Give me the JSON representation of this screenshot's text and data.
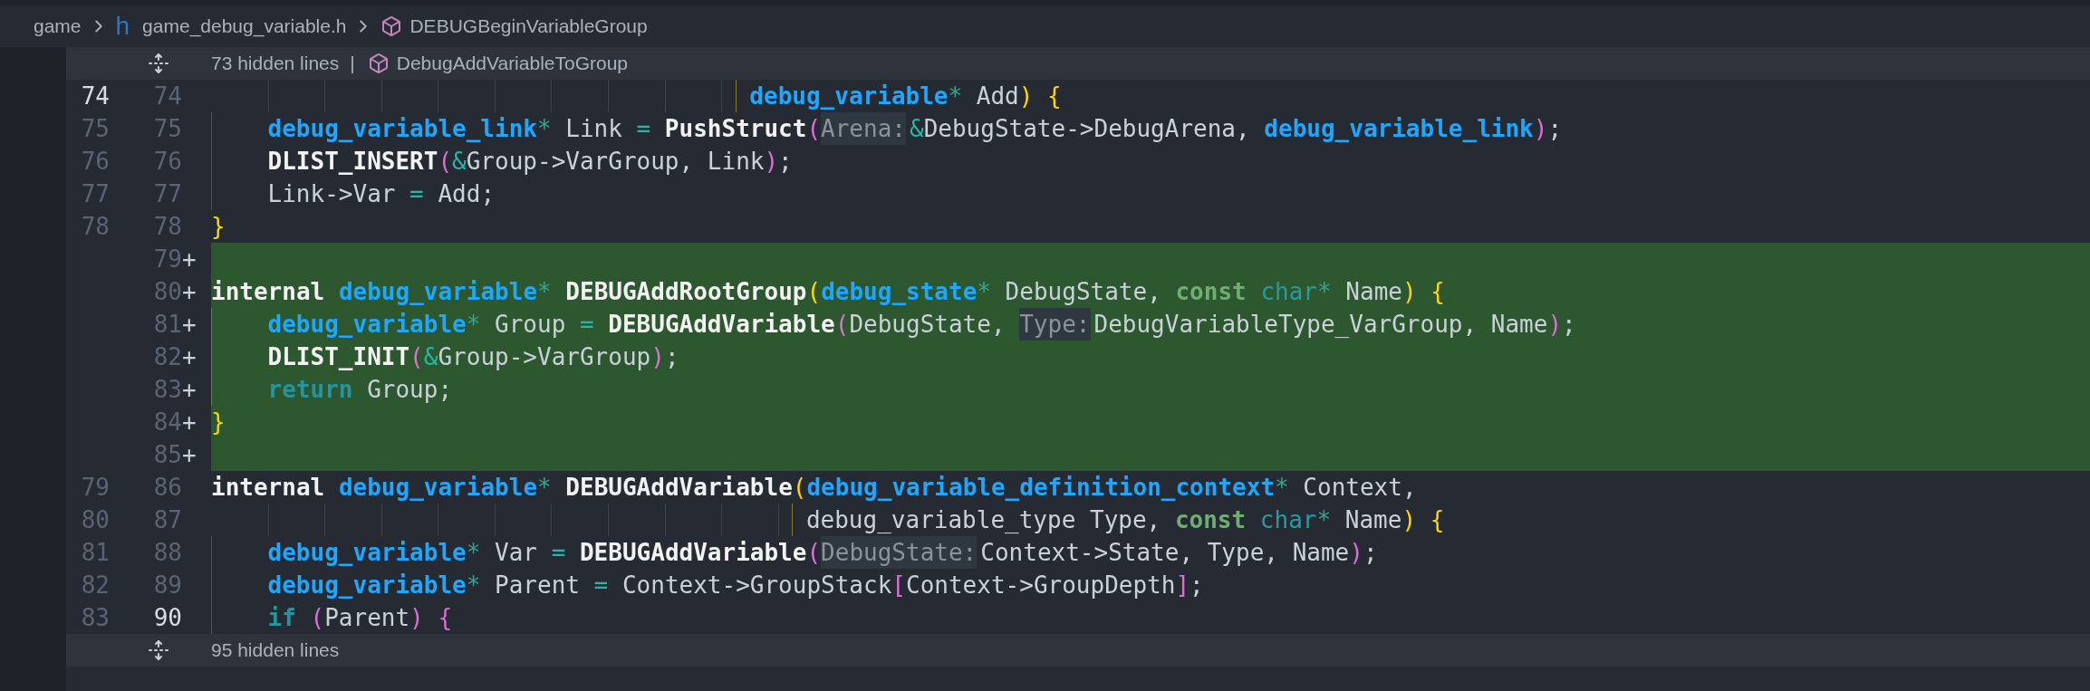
{
  "breadcrumb": {
    "folder": "game",
    "file_icon": "h",
    "file": "game_debug_variable.h",
    "symbol": "DEBUGBeginVariableGroup"
  },
  "rows": [
    {
      "kind": "fold",
      "text": "73 hidden lines",
      "separator": "|",
      "symbol": "DebugAddVariableToGroup"
    },
    {
      "kind": "code",
      "old": {
        "text": "74",
        "current": true
      },
      "new": {
        "text": "74",
        "current": false
      },
      "added": false,
      "indent": "                                      ",
      "scope_guide": false,
      "bracket_guide": true,
      "tokens": [
        {
          "kind": "type",
          "text": "debug_variable"
        },
        {
          "kind": "star",
          "text": "*"
        },
        {
          "kind": "plain",
          "text": " Add"
        },
        {
          "kind": "p1",
          "text": ")"
        },
        {
          "kind": "p1",
          "text": " {"
        }
      ]
    },
    {
      "kind": "code",
      "old": {
        "text": "75",
        "current": false
      },
      "new": {
        "text": "75",
        "current": false
      },
      "added": false,
      "indent": "    ",
      "scope_guide": true,
      "bracket_guide": false,
      "tokens": [
        {
          "kind": "type",
          "text": "debug_variable_link"
        },
        {
          "kind": "star",
          "text": "*"
        },
        {
          "kind": "plain",
          "text": " Link "
        },
        {
          "kind": "op",
          "text": "="
        },
        {
          "kind": "func",
          "text": " PushStruct"
        },
        {
          "kind": "p2",
          "text": "("
        },
        {
          "kind": "hint",
          "text": "Arena:"
        },
        {
          "kind": "op",
          "text": "&"
        },
        {
          "kind": "plain",
          "text": "DebugState->DebugArena, "
        },
        {
          "kind": "type",
          "text": "debug_variable_link"
        },
        {
          "kind": "p2",
          "text": ")"
        },
        {
          "kind": "plain",
          "text": ";"
        }
      ]
    },
    {
      "kind": "code",
      "old": {
        "text": "76",
        "current": false
      },
      "new": {
        "text": "76",
        "current": false
      },
      "added": false,
      "indent": "    ",
      "scope_guide": true,
      "bracket_guide": false,
      "tokens": [
        {
          "kind": "func",
          "text": "DLIST_INSERT"
        },
        {
          "kind": "p2",
          "text": "("
        },
        {
          "kind": "op",
          "text": "&"
        },
        {
          "kind": "plain",
          "text": "Group->VarGroup, Link"
        },
        {
          "kind": "p2",
          "text": ")"
        },
        {
          "kind": "plain",
          "text": ";"
        }
      ]
    },
    {
      "kind": "code",
      "old": {
        "text": "77",
        "current": false
      },
      "new": {
        "text": "77",
        "current": false
      },
      "added": false,
      "indent": "    ",
      "scope_guide": true,
      "bracket_guide": false,
      "tokens": [
        {
          "kind": "plain",
          "text": "Link->Var "
        },
        {
          "kind": "op",
          "text": "="
        },
        {
          "kind": "plain",
          "text": " Add;"
        }
      ]
    },
    {
      "kind": "code",
      "old": {
        "text": "78",
        "current": false
      },
      "new": {
        "text": "78",
        "current": false
      },
      "added": false,
      "tokens": [
        {
          "kind": "p1",
          "text": "}"
        }
      ]
    },
    {
      "kind": "code",
      "new": {
        "text": "79",
        "current": false
      },
      "marker": "+",
      "added": true
    },
    {
      "kind": "code",
      "new": {
        "text": "80",
        "current": false
      },
      "marker": "+",
      "added": true,
      "tokens": [
        {
          "kind": "kw",
          "text": "internal"
        },
        {
          "kind": "type",
          "text": " debug_variable"
        },
        {
          "kind": "star",
          "text": "*"
        },
        {
          "kind": "func",
          "text": " DEBUGAddRootGroup"
        },
        {
          "kind": "p1",
          "text": "("
        },
        {
          "kind": "type",
          "text": "debug_state"
        },
        {
          "kind": "star",
          "text": "*"
        },
        {
          "kind": "plain",
          "text": " DebugState, "
        },
        {
          "kind": "const",
          "text": "const"
        },
        {
          "kind": "char",
          "text": " char"
        },
        {
          "kind": "star",
          "text": "*"
        },
        {
          "kind": "plain",
          "text": " Name"
        },
        {
          "kind": "p1",
          "text": ")"
        },
        {
          "kind": "p1",
          "text": " {"
        }
      ]
    },
    {
      "kind": "code",
      "new": {
        "text": "81",
        "current": false
      },
      "marker": "+",
      "added": true,
      "indent": "    ",
      "scope_guide": true,
      "bracket_guide": false,
      "tokens": [
        {
          "kind": "type",
          "text": "debug_variable"
        },
        {
          "kind": "star",
          "text": "*"
        },
        {
          "kind": "plain",
          "text": " Group "
        },
        {
          "kind": "op",
          "text": "="
        },
        {
          "kind": "func",
          "text": " DEBUGAddVariable"
        },
        {
          "kind": "p2",
          "text": "("
        },
        {
          "kind": "plain",
          "text": "DebugState, "
        },
        {
          "kind": "hint",
          "text": "Type:"
        },
        {
          "kind": "plain",
          "text": "DebugVariableType_VarGroup, Name"
        },
        {
          "kind": "p2",
          "text": ")"
        },
        {
          "kind": "plain",
          "text": ";"
        }
      ]
    },
    {
      "kind": "code",
      "new": {
        "text": "82",
        "current": false
      },
      "marker": "+",
      "added": true,
      "indent": "    ",
      "scope_guide": true,
      "bracket_guide": false,
      "tokens": [
        {
          "kind": "func",
          "text": "DLIST_INIT"
        },
        {
          "kind": "p2",
          "text": "("
        },
        {
          "kind": "op",
          "text": "&"
        },
        {
          "kind": "plain",
          "text": "Group->VarGroup"
        },
        {
          "kind": "p2",
          "text": ")"
        },
        {
          "kind": "plain",
          "text": ";"
        }
      ]
    },
    {
      "kind": "code",
      "new": {
        "text": "83",
        "current": false
      },
      "marker": "+",
      "added": true,
      "indent": "    ",
      "scope_guide": true,
      "bracket_guide": false,
      "tokens": [
        {
          "kind": "ctrl",
          "text": "return"
        },
        {
          "kind": "plain",
          "text": " Group;"
        }
      ]
    },
    {
      "kind": "code",
      "new": {
        "text": "84",
        "current": false
      },
      "marker": "+",
      "added": true,
      "tokens": [
        {
          "kind": "p1",
          "text": "}"
        }
      ]
    },
    {
      "kind": "code",
      "new": {
        "text": "85",
        "current": false
      },
      "marker": "+",
      "added": true
    },
    {
      "kind": "code",
      "old": {
        "text": "79",
        "current": false
      },
      "new": {
        "text": "86",
        "current": false
      },
      "added": false,
      "tokens": [
        {
          "kind": "kw",
          "text": "internal"
        },
        {
          "kind": "type",
          "text": " debug_variable"
        },
        {
          "kind": "star",
          "text": "*"
        },
        {
          "kind": "func",
          "text": " DEBUGAddVariable"
        },
        {
          "kind": "p1",
          "text": "("
        },
        {
          "kind": "type",
          "text": "debug_variable_definition_context"
        },
        {
          "kind": "star",
          "text": "*"
        },
        {
          "kind": "plain",
          "text": " Context,"
        }
      ]
    },
    {
      "kind": "code",
      "old": {
        "text": "80",
        "current": false
      },
      "new": {
        "text": "87",
        "current": false
      },
      "added": false,
      "indent": "                                          ",
      "scope_guide": false,
      "bracket_guide": true,
      "tokens": [
        {
          "kind": "plain",
          "text": "debug_variable_type Type, "
        },
        {
          "kind": "const",
          "text": "const"
        },
        {
          "kind": "char",
          "text": " char"
        },
        {
          "kind": "star",
          "text": "*"
        },
        {
          "kind": "plain",
          "text": " Name"
        },
        {
          "kind": "p1",
          "text": ")"
        },
        {
          "kind": "p1",
          "text": " {"
        }
      ]
    },
    {
      "kind": "code",
      "old": {
        "text": "81",
        "current": false
      },
      "new": {
        "text": "88",
        "current": false
      },
      "added": false,
      "indent": "    ",
      "scope_guide": true,
      "bracket_guide": false,
      "tokens": [
        {
          "kind": "type",
          "text": "debug_variable"
        },
        {
          "kind": "star",
          "text": "*"
        },
        {
          "kind": "plain",
          "text": " Var "
        },
        {
          "kind": "op",
          "text": "="
        },
        {
          "kind": "func",
          "text": " DEBUGAddVariable"
        },
        {
          "kind": "p2",
          "text": "("
        },
        {
          "kind": "hint",
          "text": "DebugState:"
        },
        {
          "kind": "plain",
          "text": "Context->State, Type, Name"
        },
        {
          "kind": "p2",
          "text": ")"
        },
        {
          "kind": "plain",
          "text": ";"
        }
      ]
    },
    {
      "kind": "code",
      "old": {
        "text": "82",
        "current": false
      },
      "new": {
        "text": "89",
        "current": false
      },
      "added": false,
      "indent": "    ",
      "scope_guide": true,
      "bracket_guide": false,
      "tokens": [
        {
          "kind": "type",
          "text": "debug_variable"
        },
        {
          "kind": "star",
          "text": "*"
        },
        {
          "kind": "plain",
          "text": " Parent "
        },
        {
          "kind": "op",
          "text": "="
        },
        {
          "kind": "plain",
          "text": " Context->GroupStack"
        },
        {
          "kind": "p2",
          "text": "["
        },
        {
          "kind": "plain",
          "text": "Context->GroupDepth"
        },
        {
          "kind": "p2",
          "text": "]"
        },
        {
          "kind": "plain",
          "text": ";"
        }
      ]
    },
    {
      "kind": "code",
      "old": {
        "text": "83",
        "current": false
      },
      "new": {
        "text": "90",
        "current": true
      },
      "added": false,
      "indent": "    ",
      "scope_guide": true,
      "bracket_guide": false,
      "tokens": [
        {
          "kind": "ctrl",
          "text": "if"
        },
        {
          "kind": "p2",
          "text": " ("
        },
        {
          "kind": "plain",
          "text": "Parent"
        },
        {
          "kind": "p2",
          "text": ")"
        },
        {
          "kind": "p2",
          "text": " {"
        }
      ]
    },
    {
      "kind": "fold",
      "text": "95 hidden lines"
    }
  ]
}
